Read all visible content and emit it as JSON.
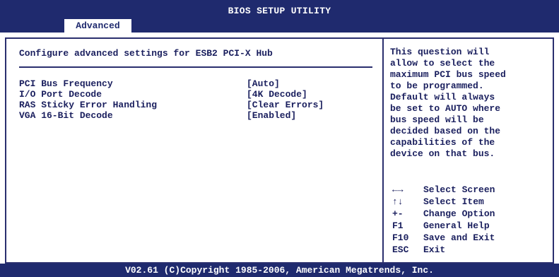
{
  "title": "BIOS SETUP UTILITY",
  "active_tab": "Advanced",
  "section_heading": "Configure advanced settings for ESB2 PCI-X Hub",
  "settings": [
    {
      "label": "PCI Bus Frequency",
      "value": "[Auto]"
    },
    {
      "label": "I/O Port Decode",
      "value": "[4K Decode]"
    },
    {
      "label": "RAS Sticky Error Handling",
      "value": "[Clear Errors]"
    },
    {
      "label": "VGA 16-Bit Decode",
      "value": "[Enabled]"
    }
  ],
  "help_text": "This question will\nallow to select the\nmaximum PCI bus speed\nto be programmed.\nDefault will always\nbe set to AUTO where\nbus speed will be\ndecided based on the\ncapabilities of the\ndevice on that bus.",
  "keys": [
    {
      "key": "←→",
      "desc": "Select Screen"
    },
    {
      "key": "↑↓",
      "desc": "Select Item"
    },
    {
      "key": "+-",
      "desc": "Change Option"
    },
    {
      "key": "F1",
      "desc": "General Help"
    },
    {
      "key": "F10",
      "desc": "Save and Exit"
    },
    {
      "key": "ESC",
      "desc": "Exit"
    }
  ],
  "footer": "V02.61 (C)Copyright 1985-2006, American Megatrends, Inc.",
  "colors": {
    "header_bg": "#1f2a6e",
    "text": "#1a1f5e"
  }
}
